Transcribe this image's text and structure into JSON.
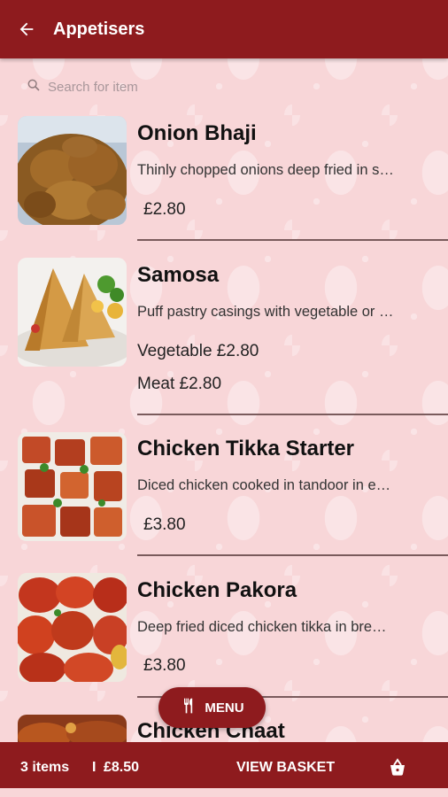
{
  "header": {
    "title": "Appetisers",
    "back_icon": "arrow-left-icon"
  },
  "search": {
    "placeholder": "Search for item",
    "icon": "search-icon"
  },
  "items": [
    {
      "name": "Onion Bhaji",
      "description": "Thinly chopped onions deep fried in s…",
      "prices": [
        "£2.80"
      ]
    },
    {
      "name": "Samosa",
      "description": "Puff pastry casings with vegetable or …",
      "prices": [
        "Vegetable £2.80",
        "Meat £2.80"
      ]
    },
    {
      "name": "Chicken Tikka Starter",
      "description": "Diced chicken cooked in tandoor in e…",
      "prices": [
        "£3.80"
      ]
    },
    {
      "name": "Chicken Pakora",
      "description": "Deep fried diced chicken tikka in bre…",
      "prices": [
        "£3.80"
      ]
    },
    {
      "name": "Chicken Chaat",
      "description": "",
      "prices": []
    }
  ],
  "menu_button": {
    "label": "MENU",
    "icon": "fork-knife-icon"
  },
  "basket_bar": {
    "count": "3 items",
    "separator": "I",
    "total": "£8.50",
    "view_label": "VIEW BASKET",
    "icon": "basket-icon"
  },
  "colors": {
    "primary": "#8e1b1e",
    "background": "#f8d6d8"
  }
}
